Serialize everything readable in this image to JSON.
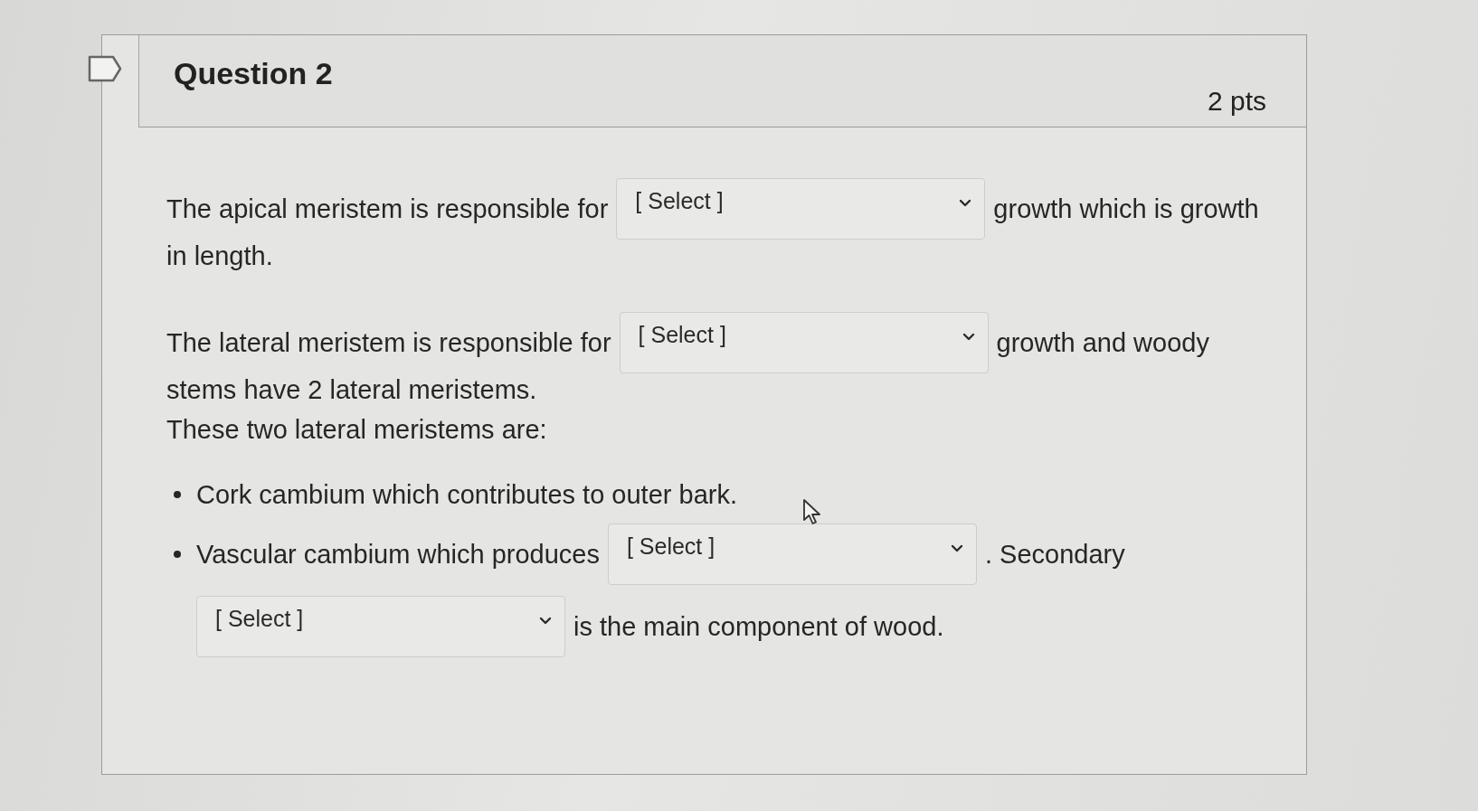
{
  "question": {
    "title": "Question 2",
    "points": "2 pts",
    "flagged": false
  },
  "body": [
    {
      "kind": "paragraph",
      "lines": [
        [
          {
            "kind": "text",
            "text": "The apical meristem is responsible for"
          },
          {
            "kind": "select",
            "value": "[ Select ]"
          },
          {
            "kind": "text",
            "text": "growth which is growth"
          }
        ],
        [
          {
            "kind": "text",
            "text": "in length."
          }
        ]
      ]
    },
    {
      "kind": "paragraph",
      "lines": [
        [
          {
            "kind": "text",
            "text": "The lateral meristem is responsible for"
          },
          {
            "kind": "select",
            "value": "[ Select ]"
          },
          {
            "kind": "text",
            "text": "growth and woody"
          }
        ],
        [
          {
            "kind": "text",
            "text": "stems have 2 lateral meristems."
          }
        ],
        [
          {
            "kind": "text",
            "text": "These two lateral meristems are:"
          }
        ]
      ]
    },
    {
      "kind": "list",
      "items": [
        {
          "lines": [
            [
              {
                "kind": "text",
                "text": "Cork cambium which contributes to outer bark."
              }
            ]
          ]
        },
        {
          "lines": [
            [
              {
                "kind": "text",
                "text": "Vascular cambium which produces"
              },
              {
                "kind": "select",
                "value": "[ Select ]"
              },
              {
                "kind": "text",
                "text": ". Secondary"
              }
            ],
            [
              {
                "kind": "select",
                "value": "[ Select ]"
              },
              {
                "kind": "text",
                "text": "is the main component of wood."
              }
            ]
          ]
        }
      ]
    }
  ]
}
